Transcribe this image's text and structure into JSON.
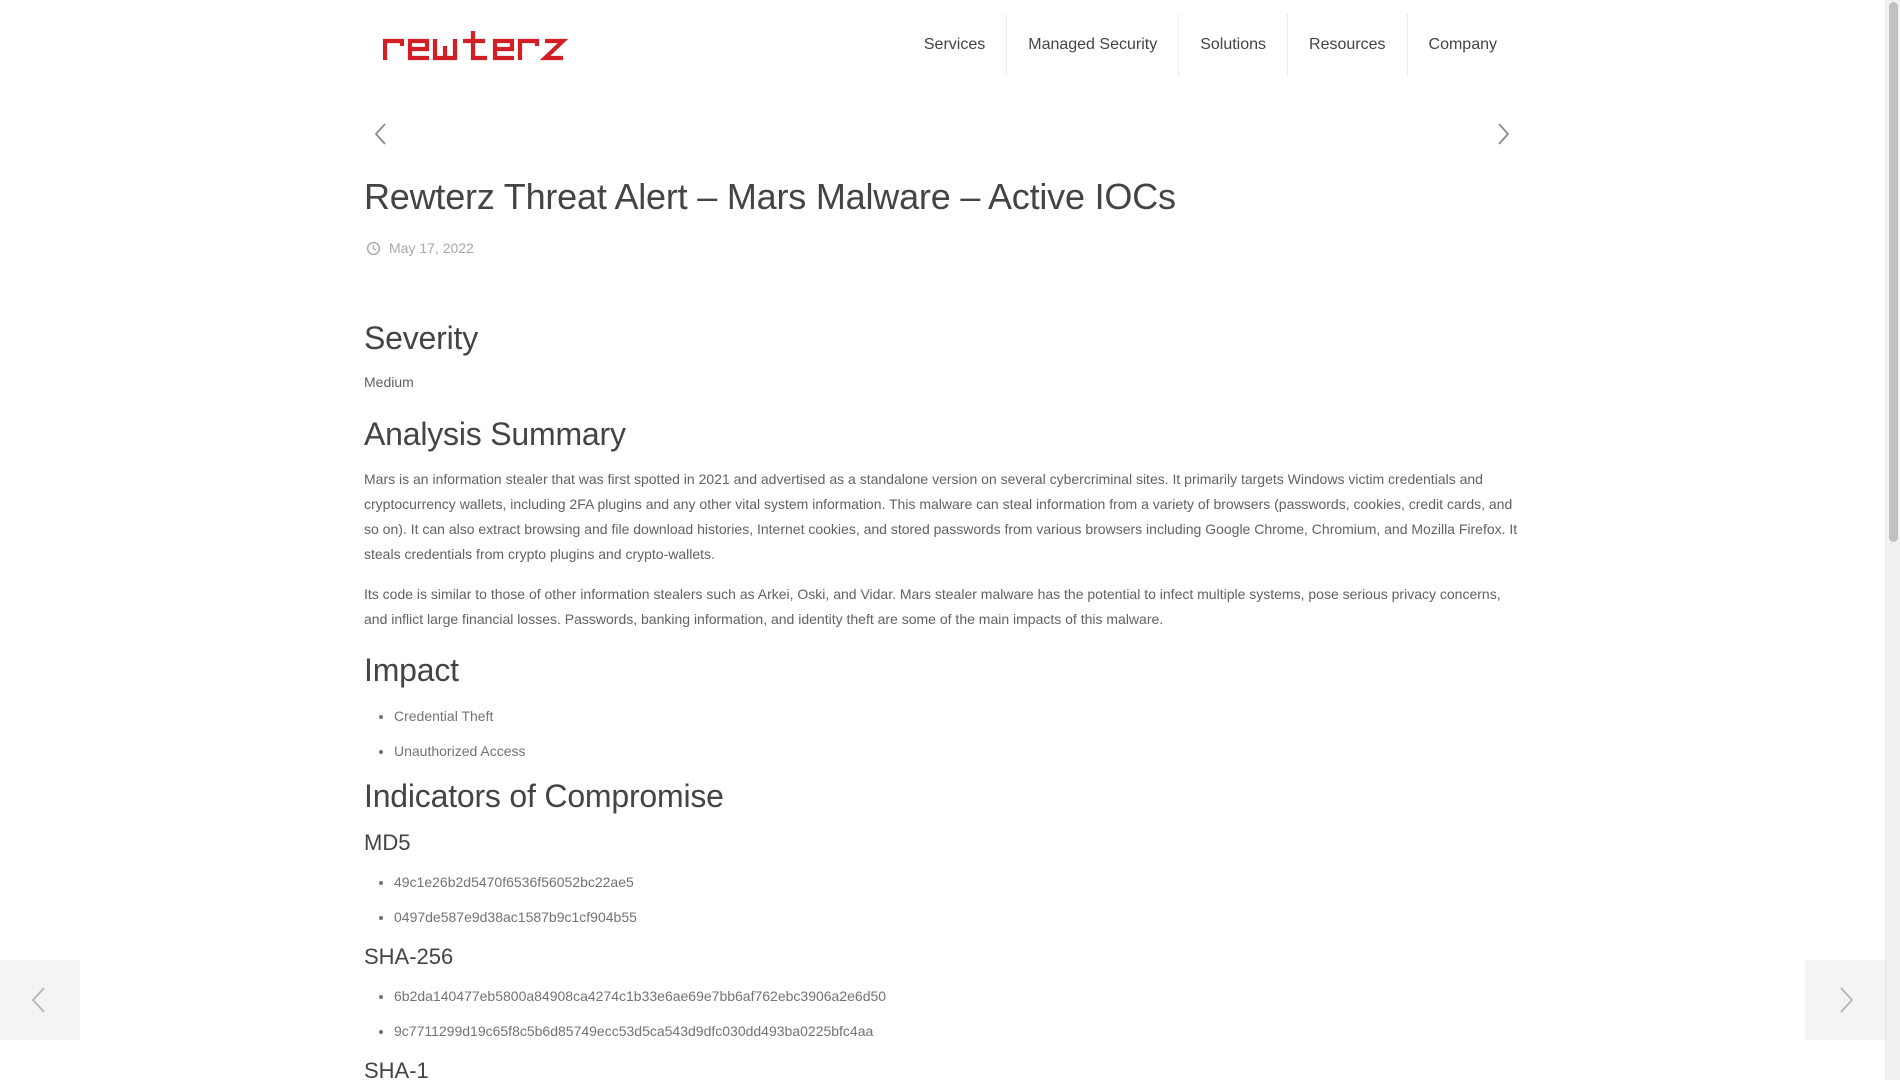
{
  "brand": {
    "logo_text": "rewterz",
    "accent_color": "#d21f26"
  },
  "nav": {
    "items": [
      {
        "label": "Services"
      },
      {
        "label": "Managed Security"
      },
      {
        "label": "Solutions"
      },
      {
        "label": "Resources"
      },
      {
        "label": "Company"
      }
    ]
  },
  "post": {
    "title": "Rewterz Threat Alert – Mars Malware – Active IOCs",
    "date": "May 17, 2022",
    "severity": {
      "heading": "Severity",
      "value": "Medium"
    },
    "analysis": {
      "heading": "Analysis Summary",
      "paragraphs": [
        "Mars is an information stealer that was first spotted in 2021 and advertised as a standalone version on several cybercriminal sites. It primarily targets Windows victim credentials and cryptocurrency wallets, including 2FA plugins and any other vital system information. This malware can steal information from a variety of browsers (passwords, cookies, credit cards, and so on). It can also extract browsing and file download histories, Internet cookies, and stored passwords from various browsers including Google Chrome, Chromium, and Mozilla Firefox. It steals credentials from crypto plugins and crypto-wallets.",
        "Its code is similar to those of other information stealers such as Arkei, Oski, and Vidar. Mars stealer malware has the potential to infect multiple systems, pose serious privacy concerns, and inflict large financial losses. Passwords, banking information, and identity theft are some of the main impacts of this malware."
      ]
    },
    "impact": {
      "heading": "Impact",
      "items": [
        "Credential Theft",
        "Unauthorized Access"
      ]
    },
    "iocs": {
      "heading": "Indicators of Compromise",
      "md5": {
        "heading": "MD5",
        "items": [
          "49c1e26b2d5470f6536f56052bc22ae5",
          "0497de587e9d38ac1587b9c1cf904b55"
        ]
      },
      "sha256": {
        "heading": "SHA-256",
        "items": [
          "6b2da140477eb5800a84908ca4274c1b33e6ae69e7bb6af762ebc3906a2e6d50",
          "9c7711299d19c65f8c5b6d85749ecc53d5ca543d9dfc030dd493ba0225bfc4aa"
        ]
      },
      "sha1": {
        "heading": "SHA-1"
      }
    }
  },
  "icons": {
    "post_prev": "chevron-left-icon",
    "post_next": "chevron-right-icon",
    "date": "clock-icon",
    "side_prev": "arrow-left-icon",
    "side_next": "arrow-right-icon"
  }
}
